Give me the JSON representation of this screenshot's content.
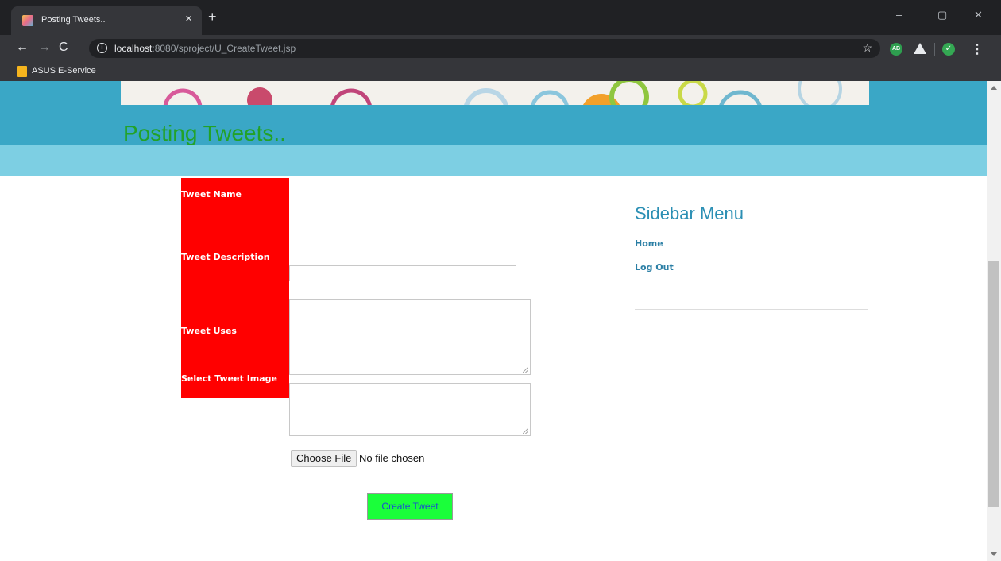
{
  "browser": {
    "tab_title": "Posting Tweets..",
    "tab_close": "×",
    "new_tab": "+",
    "window_controls": {
      "minimize": "–",
      "maximize": "▢",
      "close": "✕"
    },
    "nav": {
      "back": "←",
      "forward": "→",
      "reload": "C"
    },
    "url_host": "localhost",
    "url_rest": ":8080/sproject/U_CreateTweet.jsp",
    "info_icon": "i",
    "star_icon": "☆",
    "extensions": {
      "ab": "AB",
      "shield": "✓"
    },
    "menu": "⋮",
    "bookmark_label": "ASUS E-Service"
  },
  "page": {
    "title": "Posting Tweets..",
    "form": {
      "tweet_name_label": "Tweet Name",
      "tweet_description_label": "Tweet Description",
      "tweet_uses_label": "Tweet Uses",
      "tweet_image_label": "Select Tweet Image",
      "tweet_name_value": "",
      "tweet_description_value": "",
      "tweet_uses_value": "",
      "choose_file_label": "Choose File",
      "file_status": "No file chosen",
      "submit_label": "Create Tweet"
    },
    "sidebar": {
      "title": "Sidebar Menu",
      "links": [
        {
          "label": "Home"
        },
        {
          "label": "Log Out"
        }
      ]
    }
  },
  "colors": {
    "chrome_dark": "#202124",
    "chrome_toolbar": "#35363a",
    "header_band": "#3aa7c6",
    "header_band_light": "#7dcfe3",
    "title_green": "#22a227",
    "label_red": "#ff0000",
    "submit_green": "#1aff3a",
    "sidebar_blue": "#2b8fb4"
  }
}
